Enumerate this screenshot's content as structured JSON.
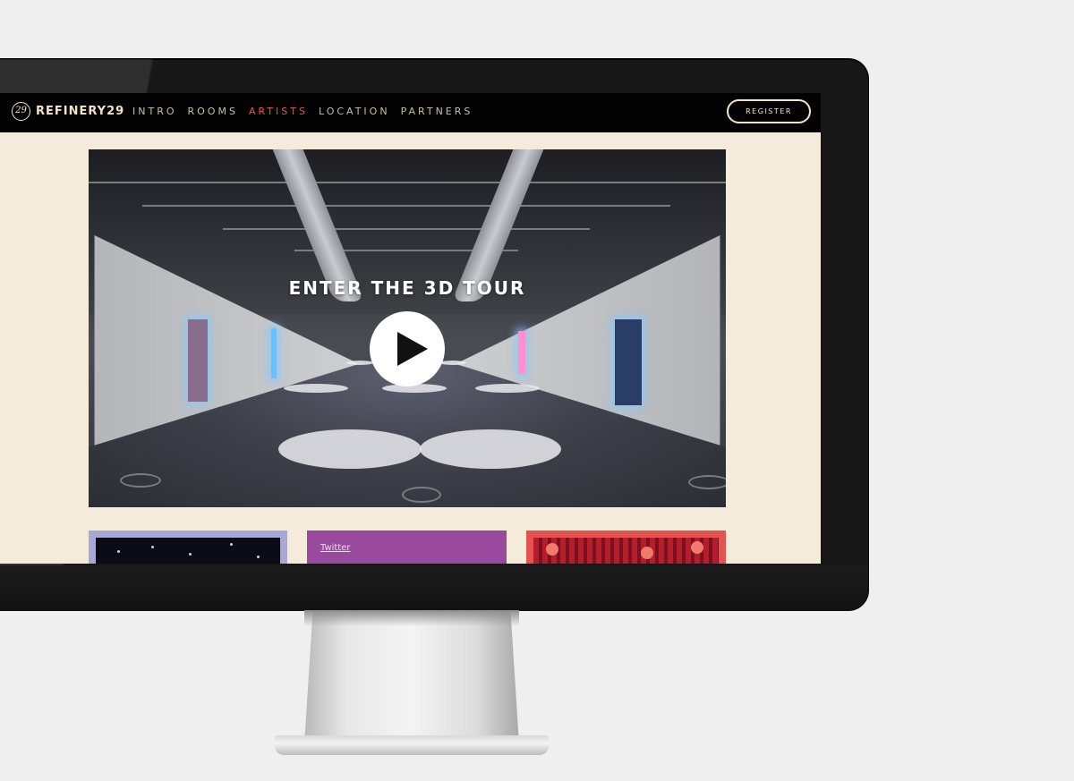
{
  "site": {
    "logo_mark": "29",
    "logo_text": "REFINERY29",
    "nav": [
      {
        "label": "INTRO",
        "active": false
      },
      {
        "label": "ROOMS",
        "active": false
      },
      {
        "label": "ARTISTS",
        "active": true
      },
      {
        "label": "LOCATION",
        "active": false
      },
      {
        "label": "PARTNERS",
        "active": false
      }
    ],
    "register_label": "REGISTER",
    "hero_title": "ENTER THE 3D TOUR",
    "cards": [
      {
        "kind": "image",
        "color": "#a9a7d5"
      },
      {
        "kind": "link",
        "label": "Twitter",
        "color": "#9a4a9d"
      },
      {
        "kind": "image",
        "color": "#e55350"
      }
    ]
  },
  "colors": {
    "nav_bg": "#030303",
    "page_bg": "#f5ebda",
    "accent_active": "#e8524e",
    "logo": "#f1e3c8"
  }
}
